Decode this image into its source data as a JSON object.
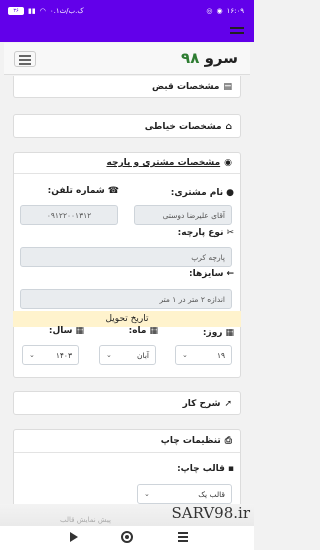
{
  "status_bar": {
    "time": "۱۶:۰۹",
    "speed": "۰.۱ک.ب/ث",
    "battery": "۳۶"
  },
  "header": {
    "brand_prefix": "سرو",
    "brand_number": "۹۸"
  },
  "sections": {
    "receipt": "مشخصات قبض",
    "tailor": "مشخصات خیاطی",
    "customer": "مشخصات مشتری و پارچه",
    "description": "شرح کار",
    "print_settings": "تنظیمات چاپ"
  },
  "customer_form": {
    "name_label": "نام مشتری:",
    "name_value": "آقای علیرضا دوستی",
    "phone_label": "شماره تلفن:",
    "phone_value": "۰۹۱۲۲۰۰۱۳۱۲",
    "fabric_label": "نوع پارچه:",
    "fabric_value": "پارچه کرپ",
    "sizes_label": "سایزها:",
    "sizes_value": "اندازه ۲ متر در ۱ متر",
    "delivery_date_label": "تاریخ تحویل",
    "day_label": "روز:",
    "day_value": "۱۹",
    "month_label": "ماه:",
    "month_value": "آبان",
    "year_label": "سال:",
    "year_value": "۱۴۰۳"
  },
  "print_form": {
    "template_label": "قالب چاپ:",
    "template_value": "قالب یک",
    "hint": "پیش نمایش قالب"
  },
  "watermark": "SARV98.ir",
  "colors": {
    "primary": "#6200ea",
    "brand_green": "#2e7d32",
    "date_highlight": "#fff3cd"
  }
}
